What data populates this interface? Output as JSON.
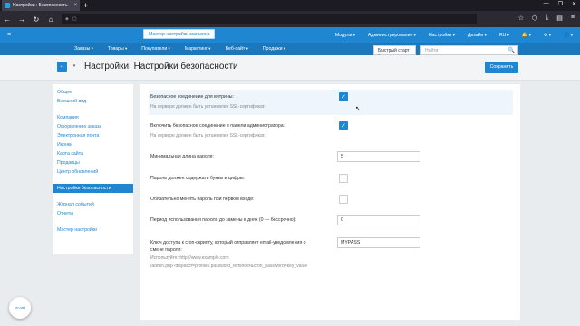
{
  "browser": {
    "tab_title": "Настройки : Безопасность",
    "tab_close": "×",
    "new_tab": "+",
    "window_controls": [
      "—",
      "❐",
      "✕"
    ],
    "nav_back": "←",
    "nav_forward": "→",
    "nav_reload": "↻",
    "nav_home": "⌂",
    "toolbar_icons": [
      "☆",
      "⬡",
      "⤓",
      "▤",
      "≡"
    ]
  },
  "topnav": {
    "home_icon": "≡",
    "wizard_label": "Мастер настройки магазина",
    "items": [
      "Модули",
      "Администрирование",
      "Настройки",
      "Дизайн",
      "RU"
    ],
    "bell_icon": "🔔",
    "gear_icon": "⚙",
    "user_icon": "👤"
  },
  "subnav": {
    "items": [
      "Заказы",
      "Товары",
      "Покупатели",
      "Маркетинг",
      "Веб-сайт",
      "Продажи"
    ],
    "quickstart": "Быстрый старт",
    "search_placeholder": "Найти",
    "search_icon": "🔍"
  },
  "page": {
    "back_icon": "←",
    "dropdown_icon": "▾",
    "title": "Настройки: Настройки безопасности",
    "save_label": "Сохранить"
  },
  "sidebar": {
    "group1": [
      "Общее",
      "Внешний вид"
    ],
    "group2": [
      "Компания",
      "Оформление заказа",
      "Электронная почта",
      "Иконки",
      "Карта сайта",
      "Продавцы",
      "Центр обновлений"
    ],
    "group3": [
      "Настройки безопасности"
    ],
    "group4": [
      "Журнал событий",
      "Отчеты"
    ],
    "group5": [
      "Мастер настройки"
    ]
  },
  "settings": {
    "secure_storefront": {
      "label": "Безопасное соединение для витрины:",
      "hint": "На сервере должен быть установлен SSL-сертификат.",
      "checked": true
    },
    "secure_admin": {
      "label": "Включить безопасное соединение в панели администратора:",
      "hint": "На сервере должен быть установлен SSL-сертификат.",
      "checked": true
    },
    "min_password_length": {
      "label": "Минимальная длина пароля:",
      "value": "5"
    },
    "letters_and_digits": {
      "label": "Пароль должен содержать буквы и цифры:",
      "checked": false
    },
    "change_on_first_login": {
      "label": "Обязательно менять пароль при первом входе:",
      "checked": false
    },
    "password_expiry": {
      "label": "Период использования пароля до замены в днях (0 — бессрочно):",
      "value": "0"
    },
    "cron_key": {
      "label": "Ключ доступа к cron-скрипту, который отправляет email-уведомления о смене пароля:",
      "value": "MYPASS",
      "hint_line1": "Используйте: http://www.example.com",
      "hint_line2": "/admin.php?dispatch=profiles.password_reminder&cron_password=key_value"
    },
    "check_mark": "✓"
  },
  "fab_label": "cs·cart",
  "colors": {
    "primary": "#1f86d1",
    "topnav": "#1f86d1",
    "subnav": "#1b78bd",
    "browser_dark": "#1c1b22"
  }
}
